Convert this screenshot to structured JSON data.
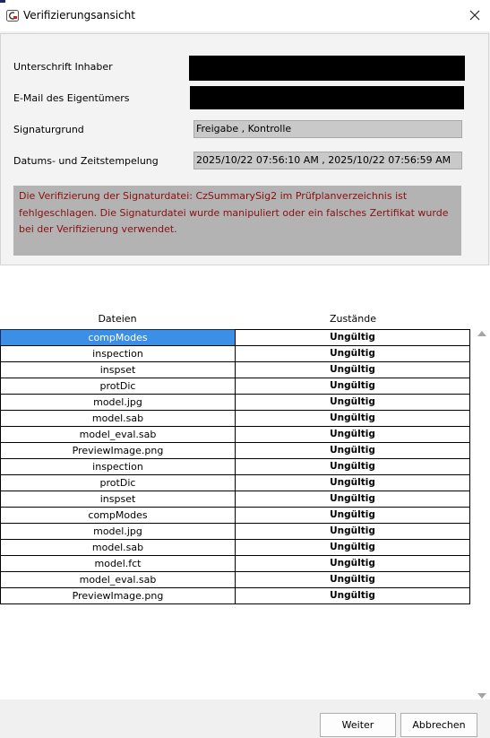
{
  "window": {
    "title": "Verifizierungsansicht",
    "app_icon": "app-icon",
    "close_icon": "close-icon"
  },
  "info": {
    "owner_signature_label": "Unterschrift Inhaber",
    "owner_email_label": "E-Mail des Eigentümers",
    "reason_label": "Signaturgrund",
    "reason_value": "Freigabe , Kontrolle",
    "timestamp_label": "Datums- und Zeitstempelung",
    "timestamp_value": "2025/10/22 07:56:10 AM , 2025/10/22 07:56:59 AM",
    "error_message": "Die Verifizierung der Signaturdatei: CzSummarySig2 im Prüfplanverzeichnis ist fehlgeschlagen. Die Signaturdatei wurde manipuliert oder ein falsches Zertifikat wurde bei der Verifizierung verwendet.",
    "error_color": "#8b0f0f"
  },
  "table": {
    "col_files": "Dateien",
    "col_states": "Zustände",
    "selected_index": 0,
    "rows": [
      {
        "file": "compModes",
        "state": "Ungültig"
      },
      {
        "file": "inspection",
        "state": "Ungültig"
      },
      {
        "file": "inspset",
        "state": "Ungültig"
      },
      {
        "file": "protDic",
        "state": "Ungültig"
      },
      {
        "file": "model.jpg",
        "state": "Ungültig"
      },
      {
        "file": "model.sab",
        "state": "Ungültig"
      },
      {
        "file": "model_eval.sab",
        "state": "Ungültig"
      },
      {
        "file": "PreviewImage.png",
        "state": "Ungültig"
      },
      {
        "file": "inspection",
        "state": "Ungültig"
      },
      {
        "file": "protDic",
        "state": "Ungültig"
      },
      {
        "file": "inspset",
        "state": "Ungültig"
      },
      {
        "file": "compModes",
        "state": "Ungültig"
      },
      {
        "file": "model.jpg",
        "state": "Ungültig"
      },
      {
        "file": "model.sab",
        "state": "Ungültig"
      },
      {
        "file": "model.fct",
        "state": "Ungültig"
      },
      {
        "file": "model_eval.sab",
        "state": "Ungültig"
      },
      {
        "file": "PreviewImage.png",
        "state": "Ungültig"
      }
    ]
  },
  "buttons": {
    "next": "Weiter",
    "cancel": "Abbrechen"
  },
  "colors": {
    "selection": "#3b8fe6",
    "redaction": "#000000",
    "field_bg": "#c9c9c9"
  }
}
